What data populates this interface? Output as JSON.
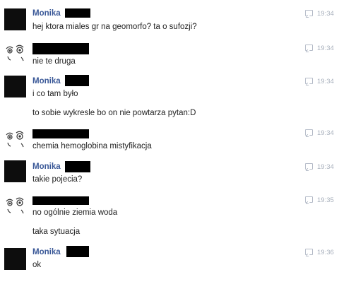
{
  "conversation": [
    {
      "sender": "Monika",
      "avatar": "black",
      "time": "19:34",
      "lines": [
        "hej ktora miales gr na geomorfo? ta o sufozji?"
      ]
    },
    {
      "sender": "",
      "avatar": "face",
      "time": "19:34",
      "lines": [
        "nie te druga"
      ]
    },
    {
      "sender": "Monika",
      "avatar": "black",
      "time": "19:34",
      "lines": [
        "i co tam było",
        "to sobie wykresle bo on nie powtarza pytan:D"
      ]
    },
    {
      "sender": "",
      "avatar": "face",
      "time": "19:34",
      "lines": [
        "chemia hemoglobina mistyfikacja"
      ]
    },
    {
      "sender": "Monika",
      "avatar": "black",
      "time": "19:34",
      "lines": [
        "takie pojecia?"
      ]
    },
    {
      "sender": "",
      "avatar": "face",
      "time": "19:35",
      "lines": [
        "no ogólnie ziemia woda",
        "taka sytuacja"
      ]
    },
    {
      "sender": "Monika",
      "avatar": "black",
      "time": "19:36",
      "lines": [
        "ok"
      ]
    }
  ],
  "icons": {
    "timestamp": "speech-bubble-icon",
    "face_avatar": "rage-face-icon"
  },
  "colors": {
    "sender_name": "#3b5998",
    "timestamp": "#a9b1bd",
    "message_text": "#222222",
    "redaction": "#000000"
  }
}
